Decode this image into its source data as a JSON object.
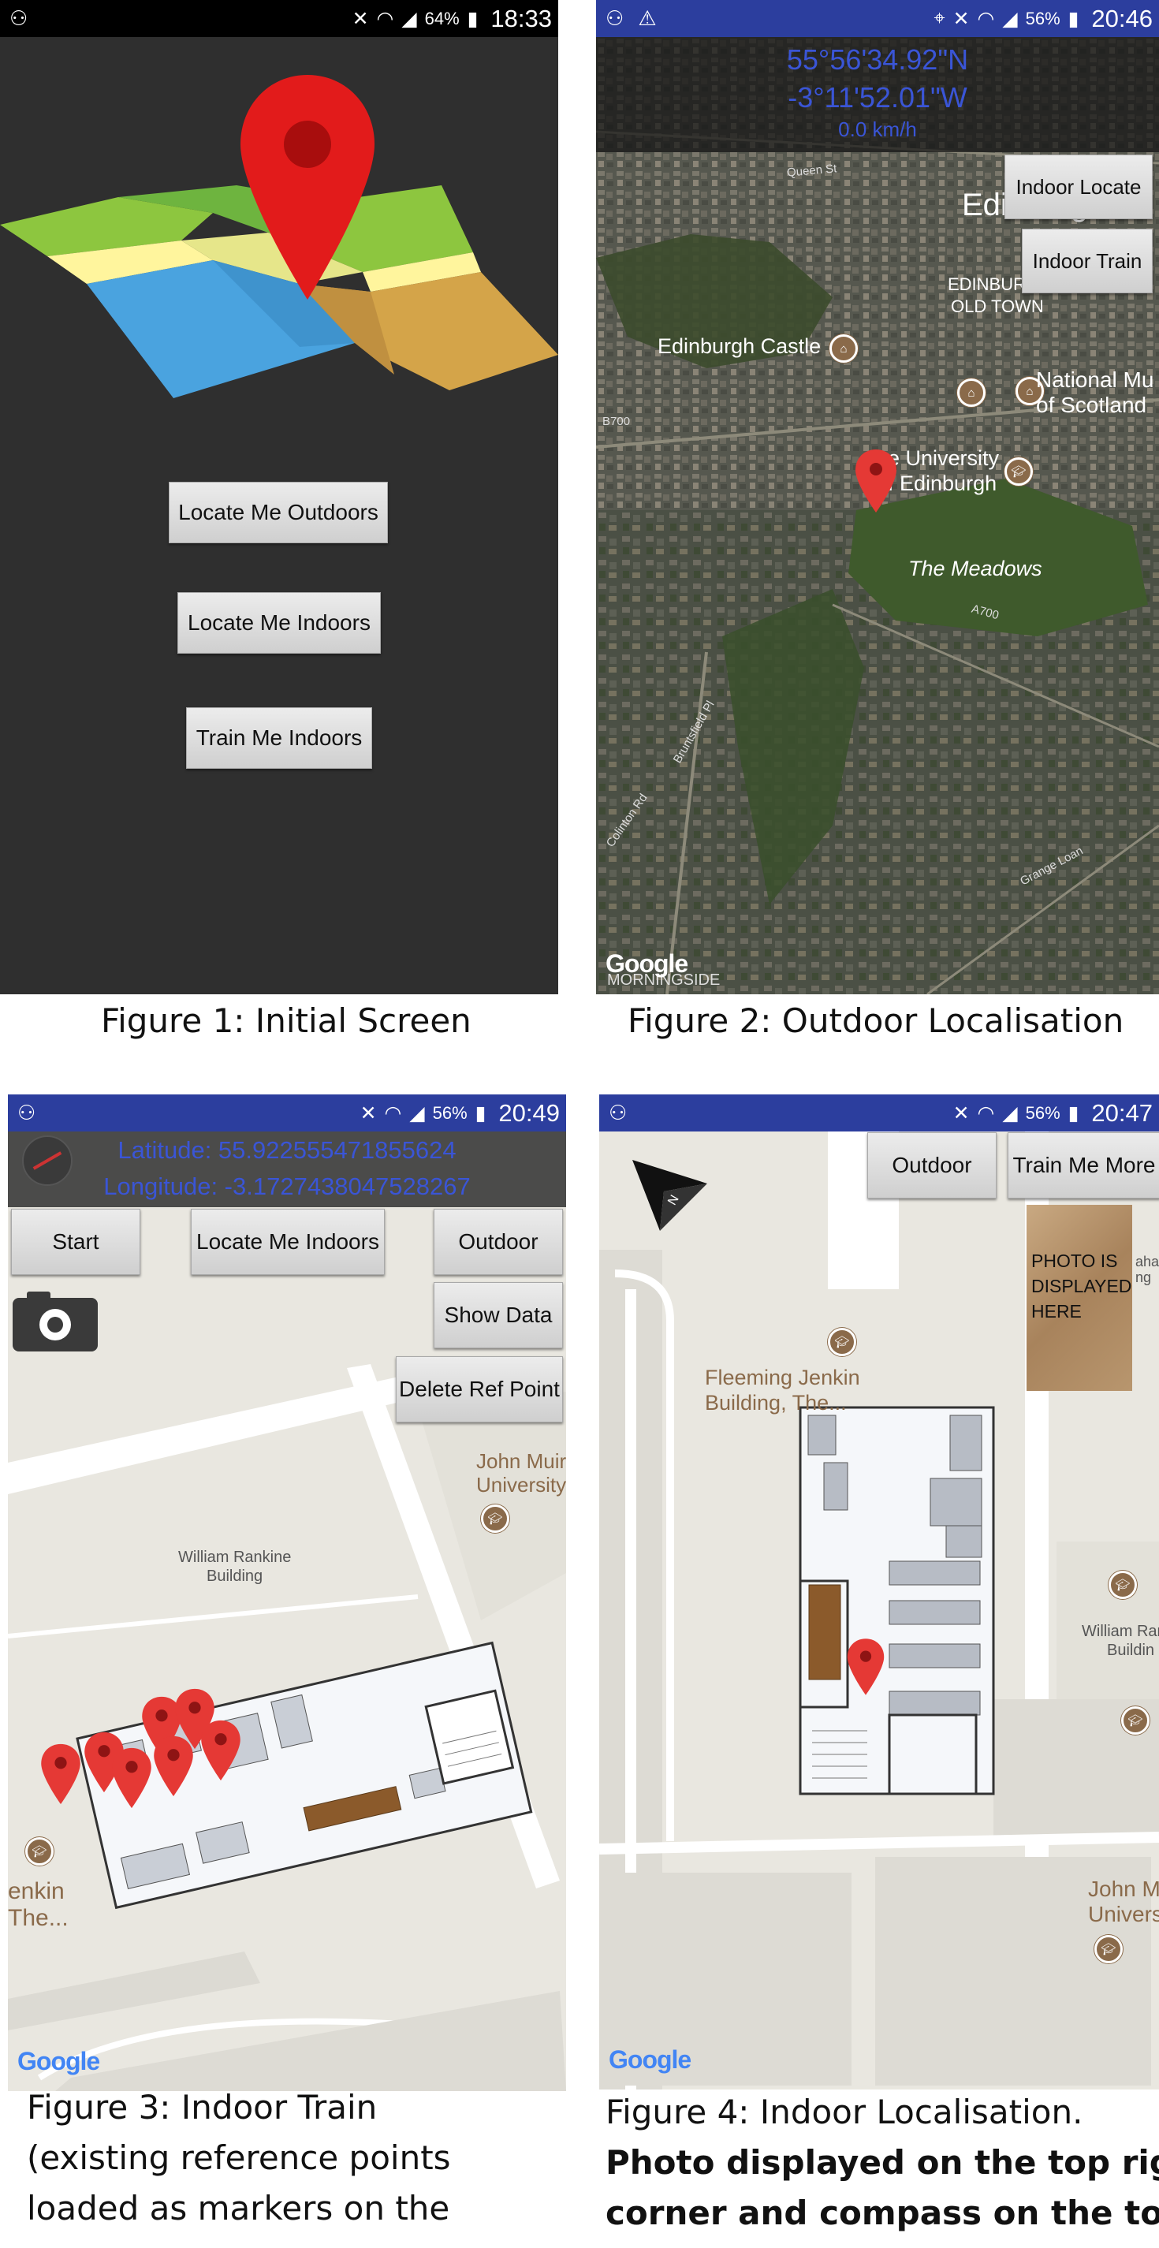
{
  "fig1": {
    "status": {
      "battery": "64%",
      "time": "18:33"
    },
    "buttons": {
      "outdoors": "Locate Me Outdoors",
      "indoors": "Locate Me Indoors",
      "train": "Train Me Indoors"
    },
    "caption": "Figure 1: Initial Screen"
  },
  "fig2": {
    "status": {
      "battery": "56%",
      "time": "20:46"
    },
    "coords": {
      "lat": "55°56'34.92\"N",
      "lon": "-3°11'52.01\"W",
      "speed": "0.0 km/h"
    },
    "buttons": {
      "indoor_locate": "Indoor Locate",
      "indoor_train": "Indoor Train"
    },
    "map_labels": {
      "queen_st": "Queen St",
      "edinburgh": "Edinburgh",
      "old_town_1": "EDINBURGH",
      "old_town_2": "OLD TOWN",
      "castle": "Edinburgh Castle",
      "museum_1": "National Mu",
      "museum_2": "of Scotland",
      "b700": "B700",
      "uni_1": "e University",
      "uni_2": "f Edinburgh",
      "meadows": "The Meadows",
      "a700": "A700",
      "bruntsfield": "Bruntsfield Pl",
      "colinton": "Colinton Rd",
      "grange": "Grange Loan",
      "morningside": "MORNINGSIDE",
      "google": "Google"
    },
    "caption": "Figure 2: Outdoor Localisation"
  },
  "fig3": {
    "status": {
      "battery": "56%",
      "time": "20:49"
    },
    "coords": {
      "lat": "Latitude: 55.922555471855624",
      "lon": "Longitude: -3.1727438047528267"
    },
    "buttons": {
      "start": "Start",
      "locate": "Locate Me Indoors",
      "outdoor": "Outdoor",
      "show_data": "Show Data",
      "delete_ref": "Delete Ref Point"
    },
    "map_labels": {
      "john_muir_1": "John Muir",
      "john_muir_2": "University",
      "rankine_1": "William Rankine",
      "rankine_2": "Building",
      "jenkin_1": "enkin",
      "jenkin_2": "The...",
      "google": "Google"
    },
    "caption_lines": [
      "Figure 3: Indoor Train",
      "(existing reference points",
      "loaded as markers on the"
    ]
  },
  "fig4": {
    "status": {
      "battery": "56%",
      "time": "20:47"
    },
    "buttons": {
      "outdoor": "Outdoor",
      "train_more": "Train Me More"
    },
    "photo_text": [
      "PHOTO IS",
      "DISPLAYED",
      "HERE"
    ],
    "photo_edge_text": [
      "aha",
      "ng"
    ],
    "map_labels": {
      "fleeming_1": "Fleeming Jenkin",
      "fleeming_2": "Building, The...",
      "rankine_1": "William Ran",
      "rankine_2": "Buildin",
      "john_1": "John M",
      "john_2": "Univers",
      "google": "Google"
    },
    "caption_line1": "Figure 4: Indoor Localisation.",
    "caption_bold": [
      "Photo displayed on the top right",
      "corner and compass on the top"
    ]
  },
  "colors": {
    "status_blue": "#2c3e9e",
    "dark_bg": "#2f2f2f",
    "pin_red": "#e53935",
    "coord_blue": "#3a55d6"
  },
  "icons": [
    "location-pin-icon",
    "camera-icon",
    "compass-icon",
    "wifi-icon",
    "signal-icon",
    "battery-icon",
    "warning-icon",
    "mute-icon",
    "university-icon"
  ]
}
